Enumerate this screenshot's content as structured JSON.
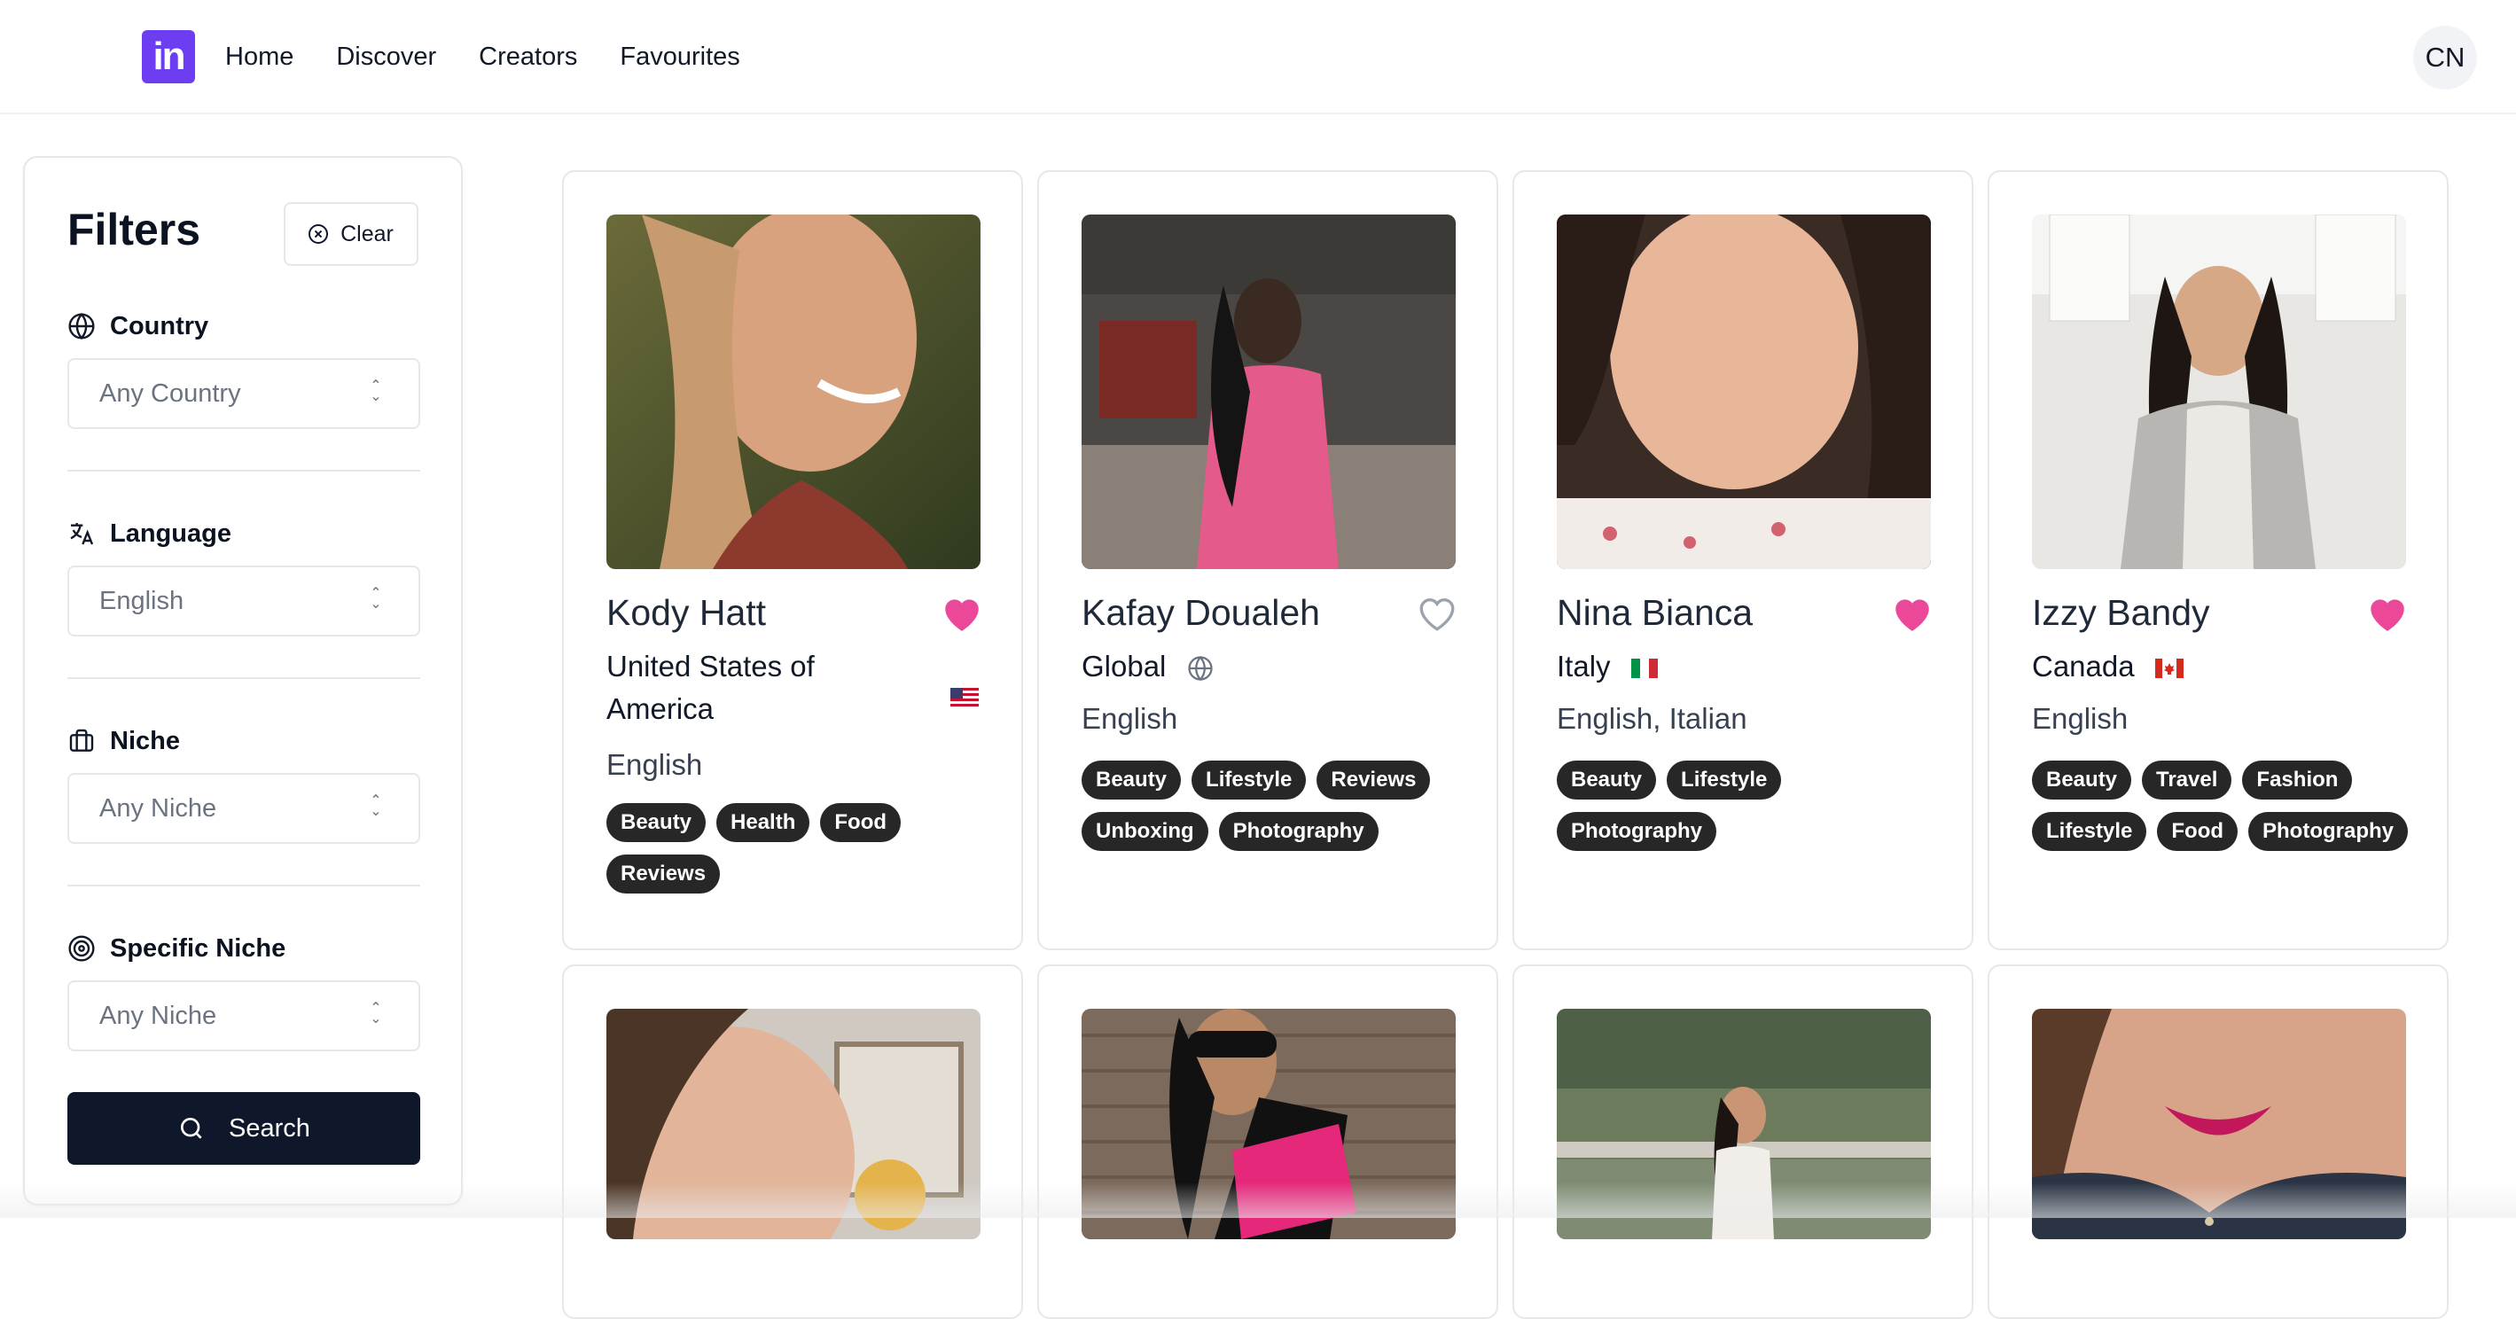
{
  "brand": {
    "logo_text": "in",
    "color": "#6d3df2"
  },
  "nav": {
    "items": [
      "Home",
      "Discover",
      "Creators",
      "Favourites"
    ]
  },
  "user": {
    "initials": "CN"
  },
  "filters": {
    "title": "Filters",
    "clear_label": "Clear",
    "country": {
      "label": "Country",
      "value": "Any Country",
      "icon": "globe-icon"
    },
    "language": {
      "label": "Language",
      "value": "English",
      "icon": "translate-icon"
    },
    "niche": {
      "label": "Niche",
      "value": "Any Niche",
      "icon": "briefcase-icon"
    },
    "specific_niche": {
      "label": "Specific Niche",
      "value": "Any Niche",
      "icon": "target-icon"
    },
    "search_label": "Search"
  },
  "creators": [
    {
      "name": "Kody Hatt",
      "country": "United States of America",
      "country_icon": "us-flag-icon",
      "languages": "English",
      "favourite": true,
      "tags": [
        "Beauty",
        "Health",
        "Food",
        "Reviews"
      ]
    },
    {
      "name": "Kafay Doualeh",
      "country": "Global",
      "country_icon": "globe-icon",
      "languages": "English",
      "favourite": false,
      "tags": [
        "Beauty",
        "Lifestyle",
        "Reviews",
        "Unboxing",
        "Photography"
      ]
    },
    {
      "name": "Nina Bianca",
      "country": "Italy",
      "country_icon": "italy-flag-icon",
      "languages": "English, Italian",
      "favourite": true,
      "tags": [
        "Beauty",
        "Lifestyle",
        "Photography"
      ]
    },
    {
      "name": "Izzy Bandy",
      "country": "Canada",
      "country_icon": "canada-flag-icon",
      "languages": "English",
      "favourite": true,
      "tags": [
        "Beauty",
        "Travel",
        "Fashion",
        "Lifestyle",
        "Food",
        "Photography"
      ]
    }
  ],
  "colors": {
    "heart_active": "#ec4899",
    "heart_inactive": "#9ca3af",
    "search_button": "#0f172a",
    "tag": "#272727"
  }
}
